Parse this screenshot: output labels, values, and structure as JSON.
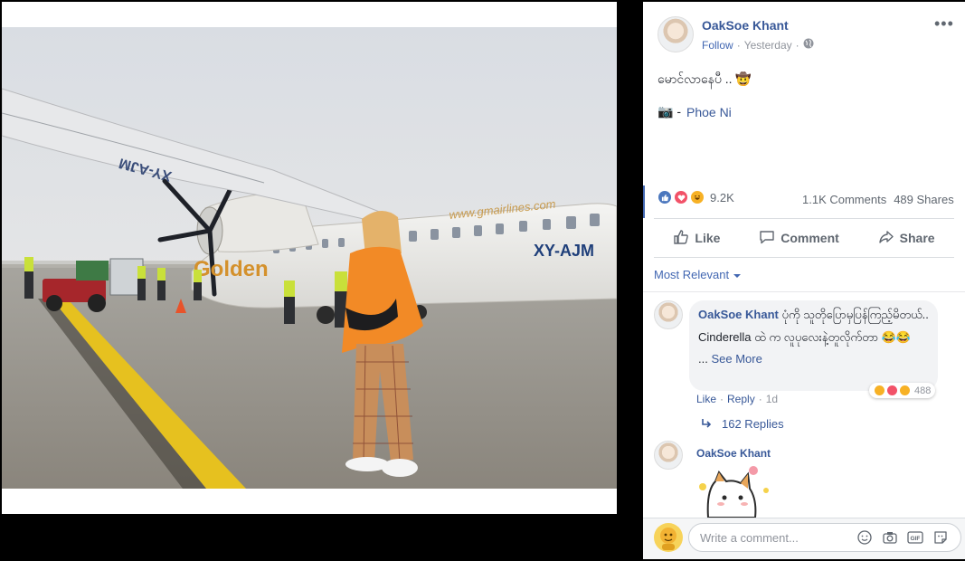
{
  "post": {
    "author": "OakSoe Khant",
    "follow": "Follow",
    "separator": "·",
    "time": "Yesterday",
    "more": "•••",
    "caption": "မောင်လာနေပီ .. 🤠",
    "credit_prefix": "📷 -",
    "credit_name": "Phoe Ni",
    "reaction_count": "9.2K",
    "comments_count": "1.1K Comments",
    "shares_count": "489 Shares"
  },
  "photo": {
    "plane_text": "www.gmairlines.com",
    "plane_reg": "XY-AJM",
    "wing_reg": "XY-AJM",
    "brand": "Golden"
  },
  "actions": {
    "like": "Like",
    "comment": "Comment",
    "share": "Share"
  },
  "comments": {
    "sort_label": "Most Relevant",
    "c1": {
      "author": "OakSoe Khant",
      "text1": " ပုံကို သူတိုပြောမှပြန်ကြည့်မိတယ်..",
      "text2": "Cinderella ထဲ က လူပုလေးနဲ့တူလိုက်တာ 😂😂",
      "see_prefix": "...",
      "see_more": "See More",
      "reaction_count": "488",
      "like": "Like",
      "reply": "Reply",
      "dot": "·",
      "age": "1d",
      "replies": "162 Replies"
    },
    "c2": {
      "author": "OakSoe Khant"
    }
  },
  "compose": {
    "placeholder": "Write a comment..."
  },
  "colors": {
    "link": "#385898",
    "accent": "#4267b2",
    "hoodie": "#f28a26"
  }
}
